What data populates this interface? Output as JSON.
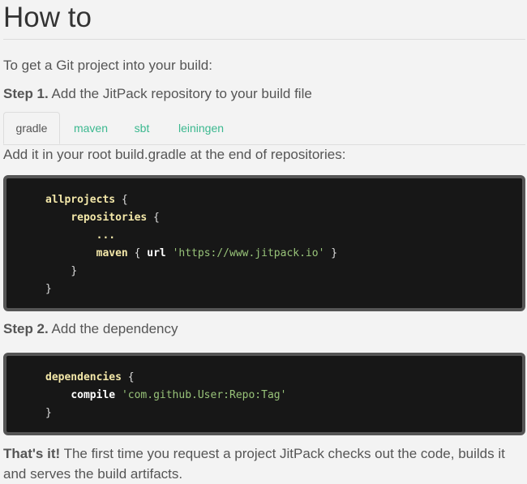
{
  "heading": "How to",
  "intro": "To get a Git project into your build:",
  "step1": {
    "label": "Step 1.",
    "text": " Add the JitPack repository to your build file"
  },
  "tabs": [
    {
      "label": "gradle",
      "active": true
    },
    {
      "label": "maven",
      "active": false
    },
    {
      "label": "sbt",
      "active": false
    },
    {
      "label": "leiningen",
      "active": false
    }
  ],
  "add_it_text": "Add it in your root build.gradle at the end of repositories:",
  "code1": {
    "l1_kw": "allprojects",
    "l1_p": " {",
    "l2_kw": "repositories",
    "l2_p": " {",
    "l3": "...",
    "l4_kw": "maven",
    "l4_p1": " { ",
    "l4_kw2": "url",
    "l4_p2": " ",
    "l4_str": "'https://www.jitpack.io'",
    "l4_p3": " }",
    "l5": "}",
    "l6": "}"
  },
  "step2": {
    "label": "Step 2.",
    "text": " Add the dependency"
  },
  "code2": {
    "l1_kw": "dependencies",
    "l1_p": " {",
    "l2_kw": "compile",
    "l2_p": " ",
    "l2_str": "'com.github.User:Repo:Tag'",
    "l3": "}"
  },
  "final": {
    "label": "That's it!",
    "text": " The first time you request a project JitPack checks out the code, builds it and serves the build artifacts."
  },
  "colors": {
    "accent": "#3bb88f",
    "code_bg": "#171717",
    "code_keyword": "#f4e8a9",
    "code_string": "#98c379"
  }
}
